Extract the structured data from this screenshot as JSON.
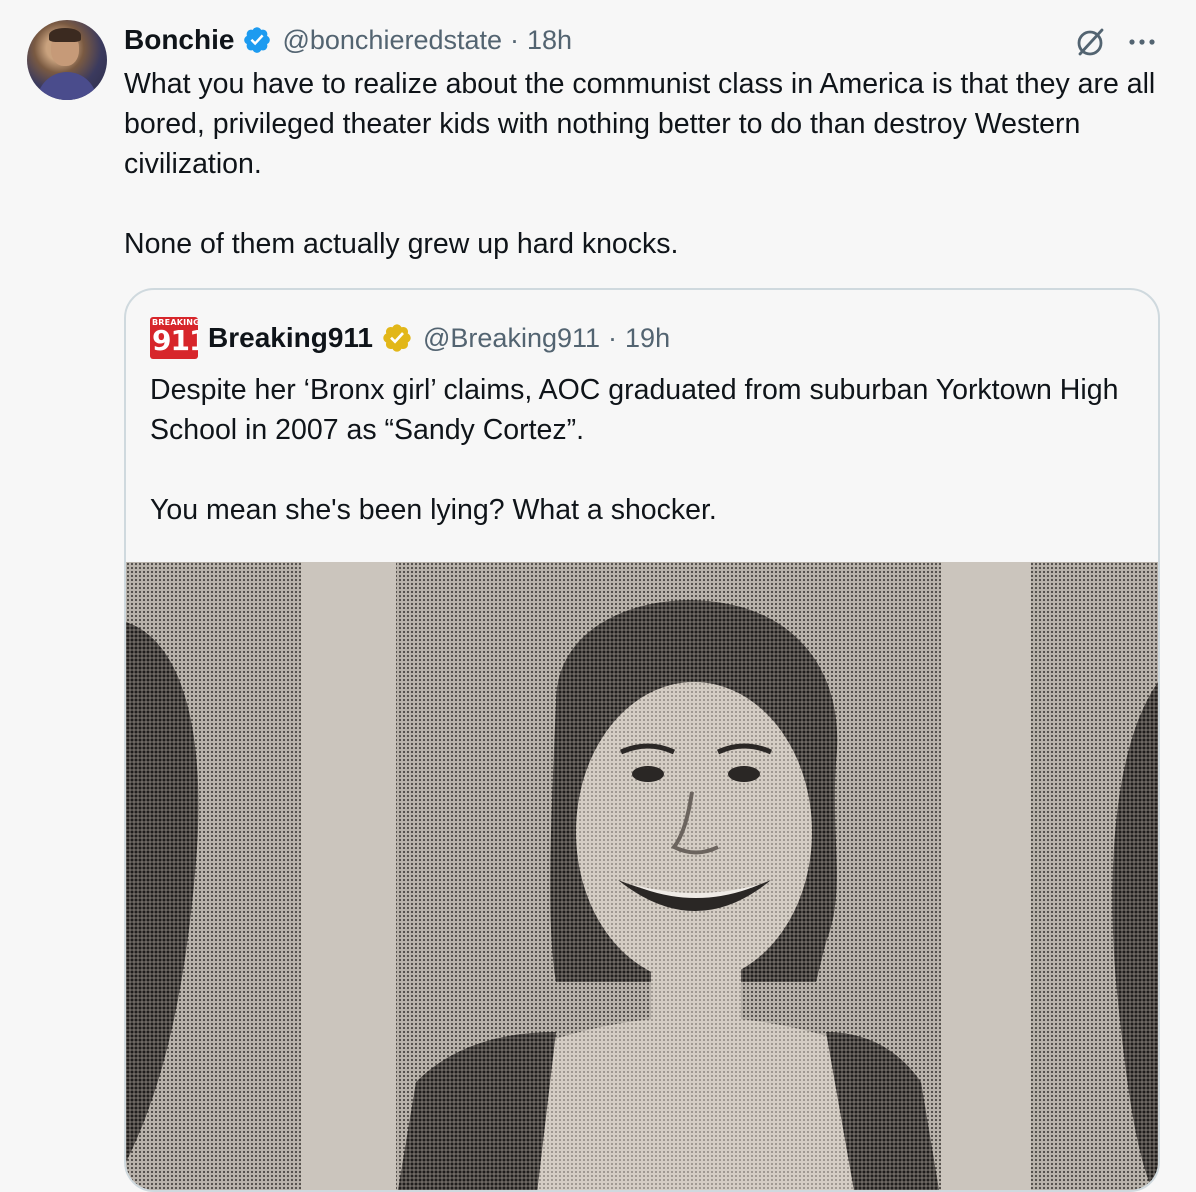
{
  "tweet": {
    "author_name": "Bonchie",
    "author_handle": "@bonchieredstate",
    "separator": "·",
    "time": "18h",
    "text": "What you have to realize about the communist class in America is that they are all bored, privileged theater kids with nothing better to do than destroy Western civilization.\n\nNone of them actually grew up hard knocks.",
    "verified_color": "#1d9bf0"
  },
  "quoted": {
    "author_name": "Breaking911",
    "author_handle": "@Breaking911",
    "separator": "·",
    "time": "19h",
    "avatar_small": "BREAKING",
    "avatar_big": "911",
    "text": "Despite her ‘Bronx girl’ claims, AOC graduated from suburban Yorktown High School in 2007 as “Sandy Cortez”.\n\nYou mean she's been lying? What a shocker.",
    "verified_color": "#e2b719",
    "avatar_color": "#d7262b"
  },
  "icons": {
    "verified": "verified-badge-icon",
    "grok": "grok-icon",
    "more": "more-icon",
    "gold_verified": "gold-verified-badge-icon"
  }
}
